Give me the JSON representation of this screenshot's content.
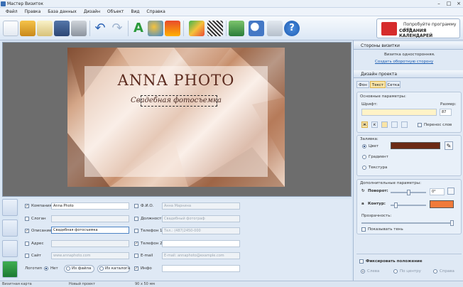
{
  "app": {
    "title": "Мастер Визиток"
  },
  "menu": [
    "Файл",
    "Правка",
    "База данных",
    "Дизайн",
    "Объект",
    "Вид",
    "Справка"
  ],
  "promo": {
    "line1": "Попробуйте программу для",
    "line2": "СОЗДАНИЯ КАЛЕНДАРЕЙ"
  },
  "card": {
    "company": "ANNA PHOTO",
    "description": "Свадебная фотосъемка"
  },
  "fields": {
    "company": {
      "label": "Компания",
      "value": "Anna Photo",
      "checked": true
    },
    "slogan": {
      "label": "Слоган",
      "value": "",
      "checked": false
    },
    "description": {
      "label": "Описание",
      "value": "Свадебная фотосъемка",
      "checked": true
    },
    "address": {
      "label": "Адрес",
      "value": "",
      "checked": false
    },
    "site": {
      "label": "Сайт",
      "value": "www.annaphoto.com",
      "checked": false
    },
    "logo": {
      "label": "Логотип",
      "options": [
        "Нет",
        "Из файла",
        "Из каталога"
      ],
      "selected": "Нет"
    },
    "fio": {
      "label": "Ф.И.О.",
      "value": "Анна Марнина",
      "checked": false
    },
    "position": {
      "label": "Должность",
      "value": "Свадебный фотограф",
      "checked": false
    },
    "phone1": {
      "label": "Телефон 1",
      "value": "Тел.: (487)2450-000",
      "checked": false
    },
    "phone2": {
      "label": "Телефон 2",
      "value": "",
      "checked": true
    },
    "email": {
      "label": "E-mail",
      "value": "E-mail: annaphoto@example.com",
      "checked": false
    },
    "info": {
      "label": "Инфо",
      "value": "",
      "checked": true
    }
  },
  "right_panel": {
    "sides_title": "Стороны визитки",
    "sides_text": "Визитка односторонняя.",
    "sides_link": "Создать оборотную сторону",
    "design_title": "Дизайн проекта",
    "tabs": [
      "Фон",
      "Текст",
      "Сетка"
    ],
    "active_tab": "Текст",
    "basic_title": "Основные параметры:",
    "font_label": "Шрифт:",
    "size_label": "Размер:",
    "size_value": "87",
    "wrap_label": "Перенос слов",
    "fill_title": "Заливка:",
    "fill_options": [
      "Цвет",
      "Градиент",
      "Текстура"
    ],
    "fill_selected": "Цвет",
    "fill_color": "#6b2a14",
    "extra_title": "Дополнительные параметры:",
    "rotate_label": "Поворот:",
    "rotate_value": "0°",
    "outline_label": "Контур:",
    "outline_color": "#f07a3a",
    "opacity_label": "Прозрачность:",
    "shadow_label": "Показывать тень",
    "fix_label": "Фиксировать положение",
    "align_options": [
      "Слева",
      "По центру",
      "Справа"
    ]
  },
  "status": {
    "type": "Визитная карта",
    "project": "Новый проект",
    "size": "90 x 50 мм"
  }
}
